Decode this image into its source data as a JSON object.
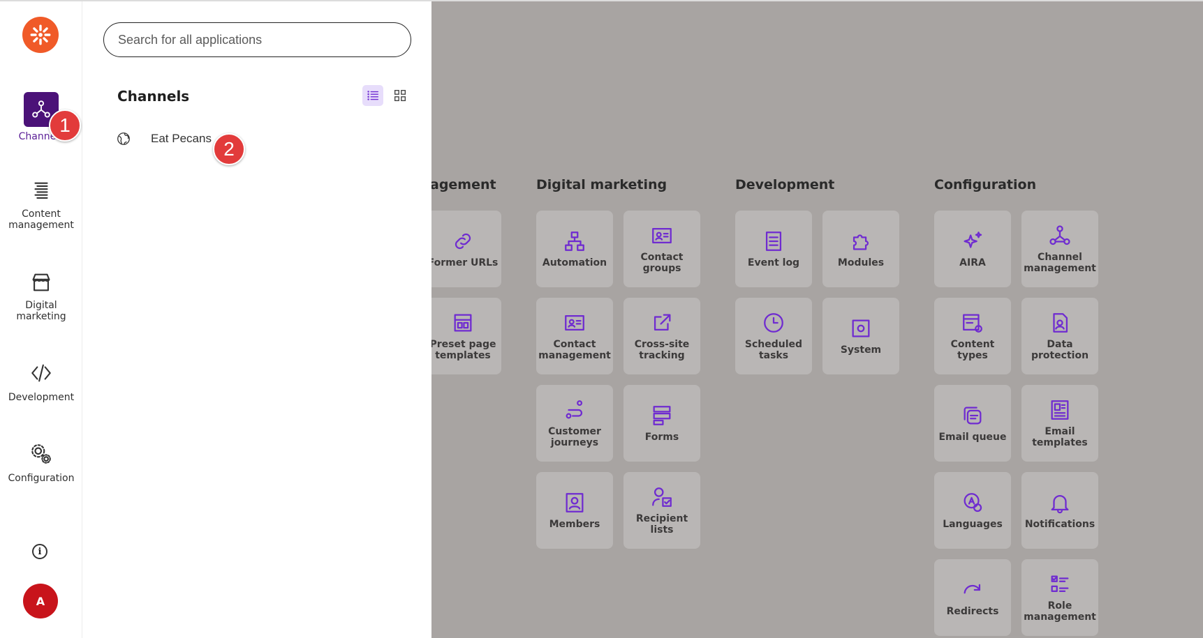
{
  "colors": {
    "accent": "#6f2bd0",
    "brand": "#f05a28",
    "rail_active": "#4b1278",
    "avatar": "#c8141b",
    "badge": "#e23b3b"
  },
  "rail": {
    "items": [
      {
        "label": "Channels",
        "icon": "channels-icon",
        "active": true
      },
      {
        "label": "Content management",
        "icon": "content-management-icon"
      },
      {
        "label": "Digital marketing",
        "icon": "store-icon"
      },
      {
        "label": "Development",
        "icon": "code-icon"
      },
      {
        "label": "Configuration",
        "icon": "gears-icon"
      }
    ],
    "avatar_initial": "A",
    "info_label": "i"
  },
  "panel": {
    "search_placeholder": "Search for all applications",
    "title": "Channels",
    "channels": [
      {
        "name": "Eat Pecans",
        "icon": "globe-icon"
      }
    ]
  },
  "badges": [
    "1",
    "2"
  ],
  "dashboard": {
    "groups": [
      {
        "title": "agement",
        "tiles": [
          "Former URLs",
          "Preset page templates"
        ]
      },
      {
        "title": "Digital marketing",
        "tiles": [
          "Automation",
          "Contact groups",
          "Contact management",
          "Cross-site tracking",
          "Customer journeys",
          "Forms",
          "Members",
          "Recipient lists"
        ]
      },
      {
        "title": "Development",
        "tiles": [
          "Event log",
          "Modules",
          "Scheduled tasks",
          "System"
        ]
      },
      {
        "title": "Configuration",
        "tiles": [
          "AIRA",
          "Channel management",
          "Content types",
          "Data protection",
          "Email queue",
          "Email templates",
          "Languages",
          "Notifications",
          "Redirects",
          "Role management"
        ]
      }
    ]
  }
}
